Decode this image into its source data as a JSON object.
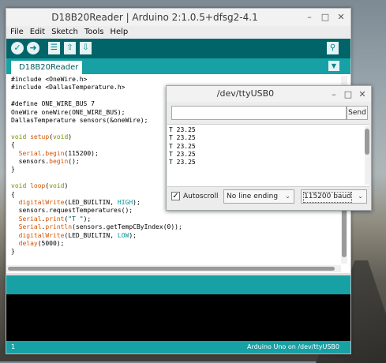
{
  "ide": {
    "title": "D18B20Reader | Arduino 2:1.0.5+dfsg2-4.1",
    "menu": [
      "File",
      "Edit",
      "Sketch",
      "Tools",
      "Help"
    ],
    "tab": "D18B20Reader",
    "code": [
      [
        [
          "#include <OneWire.h>",
          ""
        ]
      ],
      [
        [
          "#include <DallasTemperature.h>",
          ""
        ]
      ],
      [
        [
          "",
          ""
        ]
      ],
      [
        [
          "#define ONE_WIRE_BUS 7",
          ""
        ]
      ],
      [
        [
          "OneWire oneWire(ONE_WIRE_BUS);",
          ""
        ]
      ],
      [
        [
          "DallasTemperature sensors(&oneWire);",
          ""
        ]
      ],
      [
        [
          "",
          ""
        ]
      ],
      [
        [
          "void",
          "kw"
        ],
        [
          " ",
          ""
        ],
        [
          "setup",
          "fn"
        ],
        [
          "(",
          ""
        ],
        [
          "void",
          "kw"
        ],
        [
          ")",
          ""
        ]
      ],
      [
        [
          "{",
          ""
        ]
      ],
      [
        [
          "  ",
          ""
        ],
        [
          "Serial",
          "fn"
        ],
        [
          ".",
          ""
        ],
        [
          "begin",
          "fn"
        ],
        [
          "(115200);",
          ""
        ]
      ],
      [
        [
          "  sensors.",
          ""
        ],
        [
          "begin",
          "fn"
        ],
        [
          "();",
          ""
        ]
      ],
      [
        [
          "}",
          ""
        ]
      ],
      [
        [
          "",
          ""
        ]
      ],
      [
        [
          "void",
          "kw"
        ],
        [
          " ",
          ""
        ],
        [
          "loop",
          "fn"
        ],
        [
          "(",
          ""
        ],
        [
          "void",
          "kw"
        ],
        [
          ")",
          ""
        ]
      ],
      [
        [
          "{",
          ""
        ]
      ],
      [
        [
          "  ",
          ""
        ],
        [
          "digitalWrite",
          "fn"
        ],
        [
          "(LED_BUILTIN, ",
          ""
        ],
        [
          "HIGH",
          "lit"
        ],
        [
          ");",
          ""
        ]
      ],
      [
        [
          "  sensors.requestTemperatures();",
          ""
        ]
      ],
      [
        [
          "  ",
          ""
        ],
        [
          "Serial",
          "fn"
        ],
        [
          ".",
          ""
        ],
        [
          "print",
          "fn"
        ],
        [
          "(",
          ""
        ],
        [
          "\"T \"",
          "str"
        ],
        [
          ");",
          ""
        ]
      ],
      [
        [
          "  ",
          ""
        ],
        [
          "Serial",
          "fn"
        ],
        [
          ".",
          ""
        ],
        [
          "println",
          "fn"
        ],
        [
          "(sensors.getTempCByIndex(0));",
          ""
        ]
      ],
      [
        [
          "  ",
          ""
        ],
        [
          "digitalWrite",
          "fn"
        ],
        [
          "(LED_BUILTIN, ",
          ""
        ],
        [
          "LOW",
          "lit"
        ],
        [
          ");",
          ""
        ]
      ],
      [
        [
          "  ",
          ""
        ],
        [
          "delay",
          "fn"
        ],
        [
          "(5000);",
          ""
        ]
      ],
      [
        [
          "}",
          ""
        ]
      ]
    ],
    "status_line": "1",
    "status_board": "Arduino Uno on /dev/ttyUSB0"
  },
  "serial_monitor": {
    "title": "/dev/ttyUSB0",
    "input_value": "",
    "send_label": "Send",
    "output": [
      "T 23.25",
      "T 23.25",
      "T 23.25",
      "T 23.25",
      "T 23.25"
    ],
    "autoscroll_label": "Autoscroll",
    "autoscroll_checked": true,
    "line_ending": "No line ending",
    "baud": "115200 baud"
  },
  "colors": {
    "toolbar": "#006468",
    "tabbar": "#17a1a5",
    "icon_fg": "#00878f"
  },
  "icons": {
    "verify": "check-icon",
    "upload": "arrow-right-icon",
    "new": "new-file-icon",
    "open": "open-icon",
    "save": "save-icon",
    "serial_monitor": "magnifier-icon"
  }
}
